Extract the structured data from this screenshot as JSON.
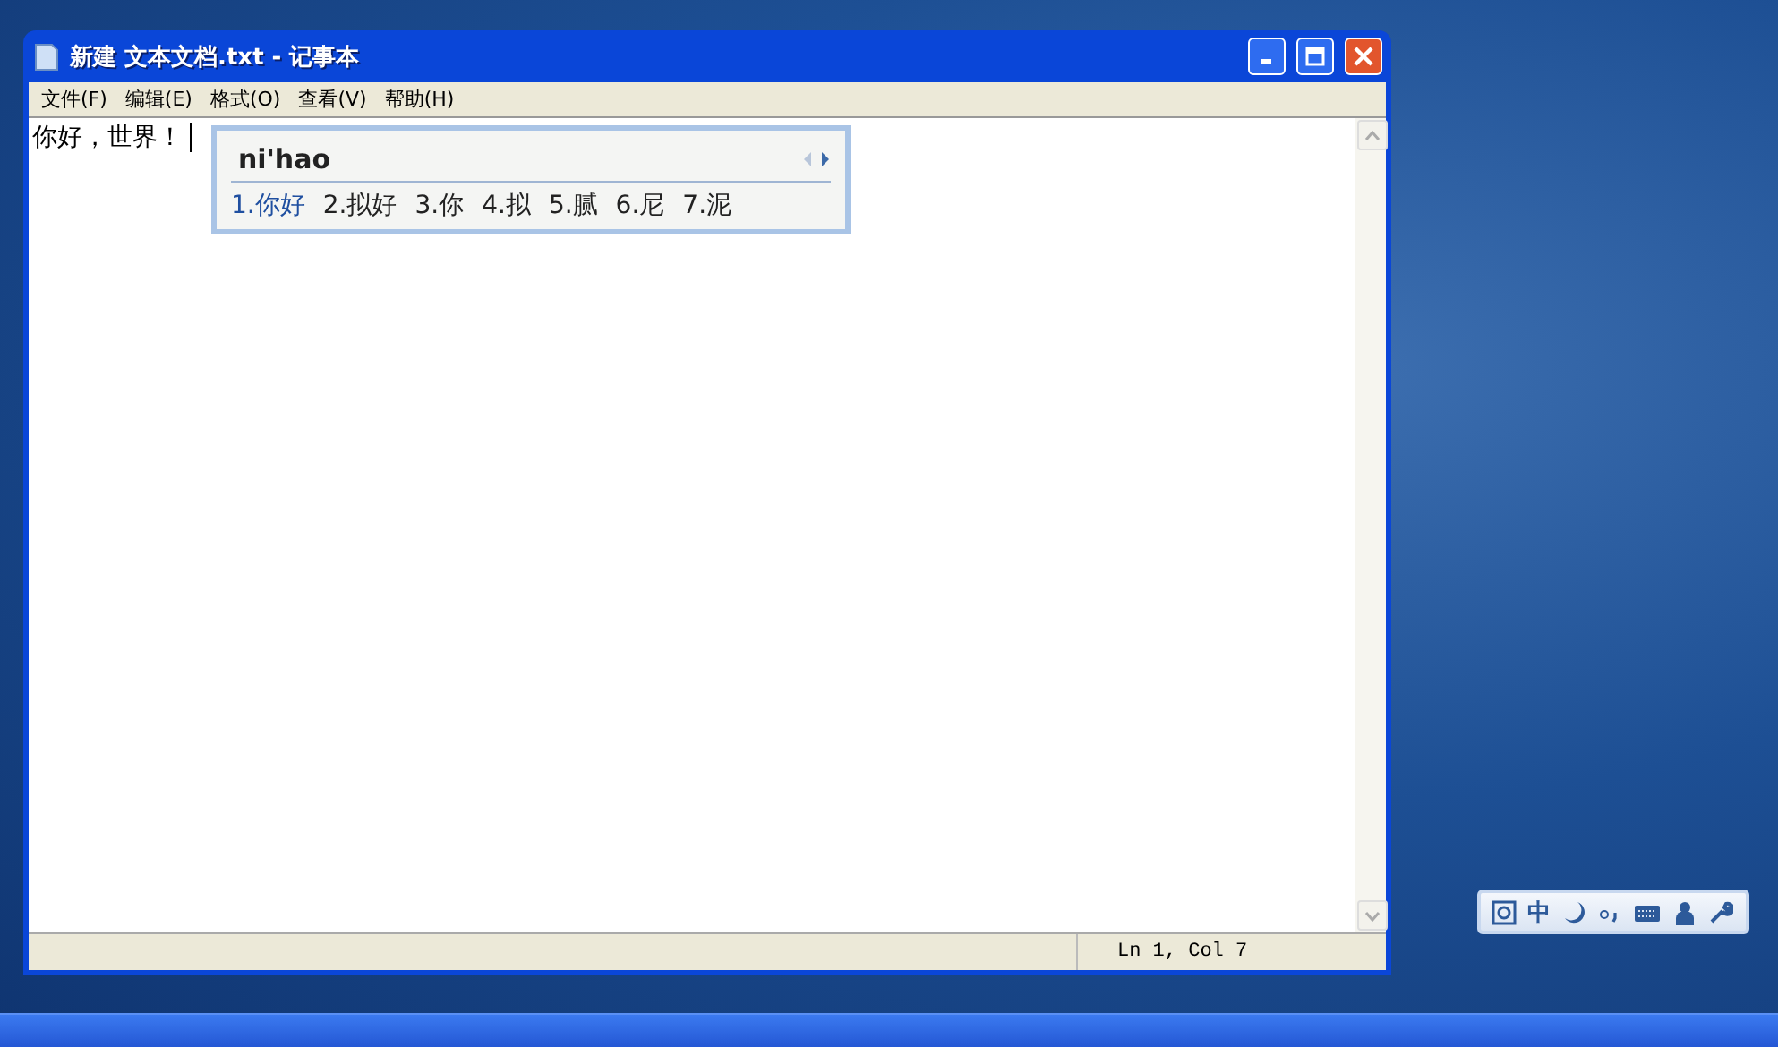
{
  "window": {
    "title": "新建 文本文档.txt - 记事本"
  },
  "menu": [
    {
      "label": "文件(F)"
    },
    {
      "label": "编辑(E)"
    },
    {
      "label": "格式(O)"
    },
    {
      "label": "查看(V)"
    },
    {
      "label": "帮助(H)"
    }
  ],
  "editor": {
    "text": "你好，世界！"
  },
  "ime_popup": {
    "composition": "ni'hao",
    "candidates": [
      {
        "label": "1.你好",
        "selected": true
      },
      {
        "label": "2.拟好",
        "selected": false
      },
      {
        "label": "3.你",
        "selected": false
      },
      {
        "label": "4.拟",
        "selected": false
      },
      {
        "label": "5.腻",
        "selected": false
      },
      {
        "label": "6.尼",
        "selected": false
      },
      {
        "label": "7.泥",
        "selected": false
      }
    ]
  },
  "status_bar": {
    "position": "Ln 1, Col 7"
  },
  "ime_toolbar": {
    "mode": "中"
  }
}
